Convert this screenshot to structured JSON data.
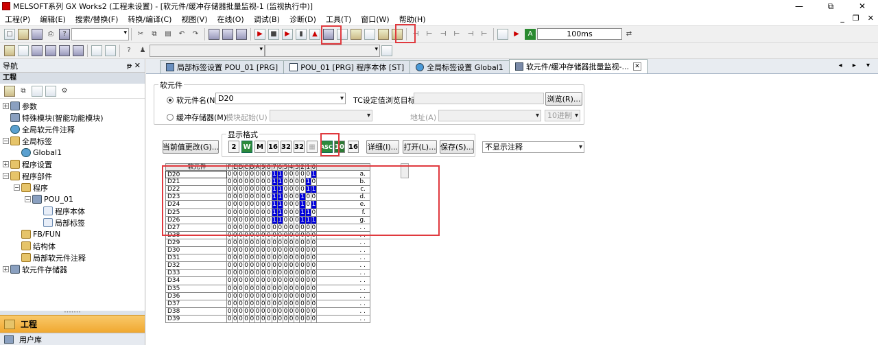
{
  "window": {
    "title": "MELSOFT系列 GX Works2 (工程未设置) - [软元件/缓冲存储器批量监视-1 (监视执行中)]",
    "min": "—",
    "max": "⧉",
    "close": "✕"
  },
  "menu": [
    "工程(P)",
    "编辑(E)",
    "搜索/替换(F)",
    "转换/编译(C)",
    "视图(V)",
    "在线(O)",
    "调试(B)",
    "诊断(D)",
    "工具(T)",
    "窗口(W)",
    "帮助(H)"
  ],
  "mdi": {
    "min": "_",
    "restore": "❐",
    "close": "✕"
  },
  "toolbar": {
    "interval": "100ms"
  },
  "nav": {
    "title": "导航",
    "pin": "ᵽ ✕",
    "section": "工程",
    "tree": [
      {
        "label": "参数",
        "level": 0,
        "exp": "+",
        "icon": "gear"
      },
      {
        "label": "特殊模块(智能功能模块)",
        "level": 0,
        "exp": "",
        "icon": "gear"
      },
      {
        "label": "全局软元件注释",
        "level": 0,
        "exp": "",
        "icon": "glob"
      },
      {
        "label": "全局标签",
        "level": 0,
        "exp": "−",
        "icon": "fold"
      },
      {
        "label": "Global1",
        "level": 1,
        "exp": "",
        "icon": "glob"
      },
      {
        "label": "程序设置",
        "level": 0,
        "exp": "+",
        "icon": "fold"
      },
      {
        "label": "程序部件",
        "level": 0,
        "exp": "−",
        "icon": "fold"
      },
      {
        "label": "程序",
        "level": 1,
        "exp": "−",
        "icon": "fold"
      },
      {
        "label": "POU_01",
        "level": 2,
        "exp": "−",
        "icon": "gear"
      },
      {
        "label": "程序本体",
        "level": 3,
        "exp": "",
        "icon": "doc"
      },
      {
        "label": "局部标签",
        "level": 3,
        "exp": "",
        "icon": "doc"
      },
      {
        "label": "FB/FUN",
        "level": 1,
        "exp": "",
        "icon": "fold"
      },
      {
        "label": "结构体",
        "level": 1,
        "exp": "",
        "icon": "fold"
      },
      {
        "label": "局部软元件注释",
        "level": 1,
        "exp": "",
        "icon": "fold"
      },
      {
        "label": "软元件存储器",
        "level": 0,
        "exp": "+",
        "icon": "gear"
      }
    ],
    "footer1": "工程",
    "footer2": "用户库"
  },
  "tabs": [
    {
      "label": "局部标签设置 POU_01 [PRG]"
    },
    {
      "label": "POU_01 [PRG] 程序本体 [ST]"
    },
    {
      "label": "全局标签设置 Global1"
    },
    {
      "label": "软元件/缓冲存储器批量监视-..."
    }
  ],
  "tabnav": "◂ ▸ ▾",
  "tabclose": "✕",
  "panel": {
    "group_device": "软元件",
    "device_name_label": "软元件名(N)",
    "device_name_value": "D20",
    "tc_label": "TC设定值浏览目标",
    "browse_btn": "浏览(R)...",
    "buffer_label": "缓冲存储器(M)",
    "module_start_label": "模块起始(U)",
    "address_label": "地址(A)",
    "radix_value": "10进制",
    "group_display": "显示格式",
    "change_btn": "当前值更改(G)...",
    "fmt_buttons": [
      "2",
      "W",
      "M",
      "16",
      "32",
      "32",
      "▦",
      "ASC",
      "10",
      "16"
    ],
    "detail_btn": "详细(I)...",
    "open_btn": "打开(L)...",
    "save_btn": "保存(S)...",
    "comment_select": "不显示注释"
  },
  "grid": {
    "header_device": "软元件",
    "header_bits": [
      "F",
      "E",
      "D",
      "C",
      "B",
      "A",
      "9",
      "8",
      "7",
      "6",
      "5",
      "4",
      "3",
      "2",
      "1",
      "0"
    ],
    "rows": [
      {
        "dev": "D20",
        "bits": "0000000011000001",
        "str": "a."
      },
      {
        "dev": "D21",
        "bits": "0000000011000010",
        "str": "b."
      },
      {
        "dev": "D22",
        "bits": "0000000011000011",
        "str": "c."
      },
      {
        "dev": "D23",
        "bits": "0000000011000100",
        "str": "d."
      },
      {
        "dev": "D24",
        "bits": "0000000011000101",
        "str": "e."
      },
      {
        "dev": "D25",
        "bits": "0000000011000110",
        "str": "f."
      },
      {
        "dev": "D26",
        "bits": "0000000011000111",
        "str": "g."
      },
      {
        "dev": "D27",
        "bits": "0000000000000000",
        "str": ". ."
      },
      {
        "dev": "D28",
        "bits": "0000000000000000",
        "str": ". ."
      },
      {
        "dev": "D29",
        "bits": "0000000000000000",
        "str": ". ."
      },
      {
        "dev": "D30",
        "bits": "0000000000000000",
        "str": ". ."
      },
      {
        "dev": "D31",
        "bits": "0000000000000000",
        "str": ". ."
      },
      {
        "dev": "D32",
        "bits": "0000000000000000",
        "str": ". ."
      },
      {
        "dev": "D33",
        "bits": "0000000000000000",
        "str": ". ."
      },
      {
        "dev": "D34",
        "bits": "0000000000000000",
        "str": ". ."
      },
      {
        "dev": "D35",
        "bits": "0000000000000000",
        "str": ". ."
      },
      {
        "dev": "D36",
        "bits": "0000000000000000",
        "str": ". ."
      },
      {
        "dev": "D37",
        "bits": "0000000000000000",
        "str": ". ."
      },
      {
        "dev": "D38",
        "bits": "0000000000000000",
        "str": ". ."
      },
      {
        "dev": "D39",
        "bits": "0000000000000000",
        "str": ". ."
      }
    ]
  }
}
